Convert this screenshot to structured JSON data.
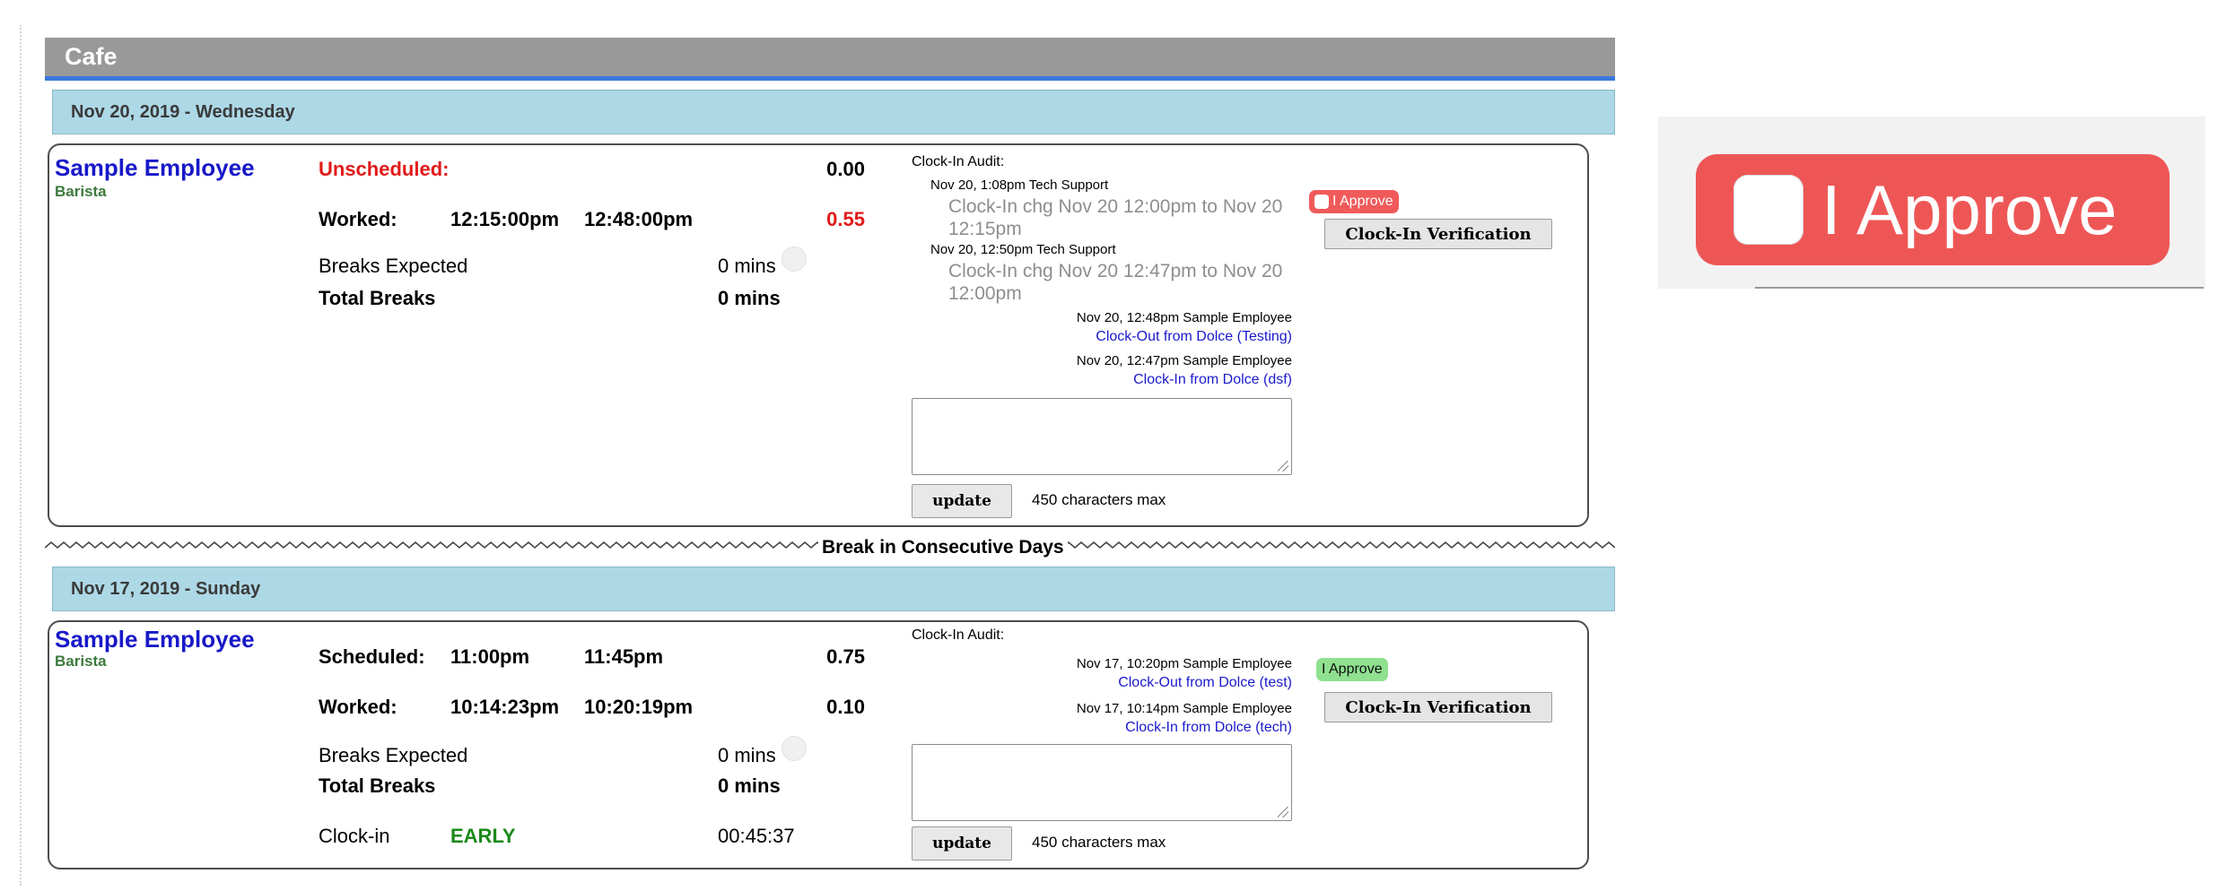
{
  "section": {
    "title": "Cafe"
  },
  "break_label": "Break in Consecutive Days",
  "days": [
    {
      "date_label": "Nov 20, 2019 - Wednesday",
      "employee": {
        "name": "Sample Employee",
        "role": "Barista"
      },
      "rows": {
        "first": {
          "label": "Unscheduled:",
          "start": "",
          "end": "",
          "hours": "0.00"
        },
        "worked": {
          "label": "Worked:",
          "start": "12:15:00pm",
          "end": "12:48:00pm",
          "hours": "0.55"
        },
        "breaks_expected": {
          "label": "Breaks Expected",
          "value": "0 mins"
        },
        "total_breaks": {
          "label": "Total Breaks",
          "value": "0 mins"
        }
      },
      "audit": {
        "title": "Clock-In Audit:",
        "changes": [
          {
            "meta": "Nov 20, 1:08pm Tech Support",
            "text": "Clock-In chg Nov 20 12:00pm to Nov 20 12:15pm"
          },
          {
            "meta": "Nov 20, 12:50pm Tech Support",
            "text": "Clock-In chg Nov 20 12:47pm to Nov 20 12:00pm"
          }
        ],
        "events": [
          {
            "meta": "Nov 20, 12:48pm Sample Employee",
            "link": "Clock-Out from Dolce (Testing)"
          },
          {
            "meta": "Nov 20, 12:47pm Sample Employee",
            "link": "Clock-In from Dolce (dsf)"
          }
        ],
        "note_value": "",
        "update_label": "update",
        "chars_hint": "450 characters max"
      },
      "approve": {
        "label": "I Approve",
        "state": "unapproved",
        "color": "#f05a5a"
      },
      "verify_label": "Clock-In Verification"
    },
    {
      "date_label": "Nov 17, 2019 - Sunday",
      "employee": {
        "name": "Sample Employee",
        "role": "Barista"
      },
      "rows": {
        "first": {
          "label": "Scheduled:",
          "start": "11:00pm",
          "end": "11:45pm",
          "hours": "0.75"
        },
        "worked": {
          "label": "Worked:",
          "start": "10:14:23pm",
          "end": "10:20:19pm",
          "hours": "0.10"
        },
        "breaks_expected": {
          "label": "Breaks Expected",
          "value": "0 mins"
        },
        "total_breaks": {
          "label": "Total Breaks",
          "value": "0 mins"
        },
        "clock_in": {
          "label": "Clock-in",
          "status": "EARLY",
          "value": "00:45:37"
        }
      },
      "audit": {
        "title": "Clock-In Audit:",
        "events": [
          {
            "meta": "Nov 17, 10:20pm Sample Employee",
            "link": "Clock-Out from Dolce (test)"
          },
          {
            "meta": "Nov 17, 10:14pm Sample Employee",
            "link": "Clock-In from Dolce (tech)"
          }
        ],
        "note_value": "",
        "update_label": "update",
        "chars_hint": "450 characters max"
      },
      "approve": {
        "label": "I Approve",
        "state": "approved",
        "color": "#8fe08f"
      },
      "verify_label": "Clock-In Verification"
    }
  ],
  "zoom_callout": {
    "label": "I Approve",
    "color": "#ee5656"
  }
}
